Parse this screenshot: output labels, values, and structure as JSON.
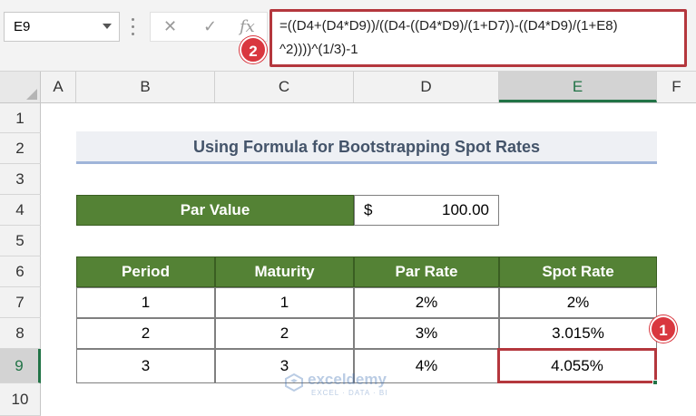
{
  "name_box": {
    "value": "E9"
  },
  "formula_bar": {
    "cancel_glyph": "✕",
    "enter_glyph": "✓",
    "fx_label": "fx",
    "formula_line1": "=((D4+(D4*D9))/((D4-((D4*D9)/(1+D7))-((D4*D9)/(1+E8)",
    "formula_line2": "^2))))^(1/3)-1"
  },
  "columns": [
    "A",
    "B",
    "C",
    "D",
    "E",
    "F"
  ],
  "selected_column": "E",
  "rows": [
    "1",
    "2",
    "3",
    "4",
    "5",
    "6",
    "7",
    "8",
    "9",
    "10"
  ],
  "selected_row": "9",
  "sheet": {
    "title": "Using Formula for Bootstrapping Spot Rates",
    "par_value": {
      "label": "Par Value",
      "currency": "$",
      "value": "100.00"
    },
    "table": {
      "headers": [
        "Period",
        "Maturity",
        "Par Rate",
        "Spot Rate"
      ],
      "rows": [
        [
          "1",
          "1",
          "2%",
          "2%"
        ],
        [
          "2",
          "2",
          "3%",
          "3.015%"
        ],
        [
          "3",
          "3",
          "4%",
          "4.055%"
        ]
      ]
    }
  },
  "badges": {
    "cell_marker": "1",
    "formula_marker": "2"
  },
  "watermark": {
    "name": "exceldemy",
    "tagline": "EXCEL · DATA · BI"
  },
  "colors": {
    "header_green": "#548235",
    "highlight_red": "#b4373d",
    "title_text": "#44546a",
    "excel_green": "#217346"
  }
}
